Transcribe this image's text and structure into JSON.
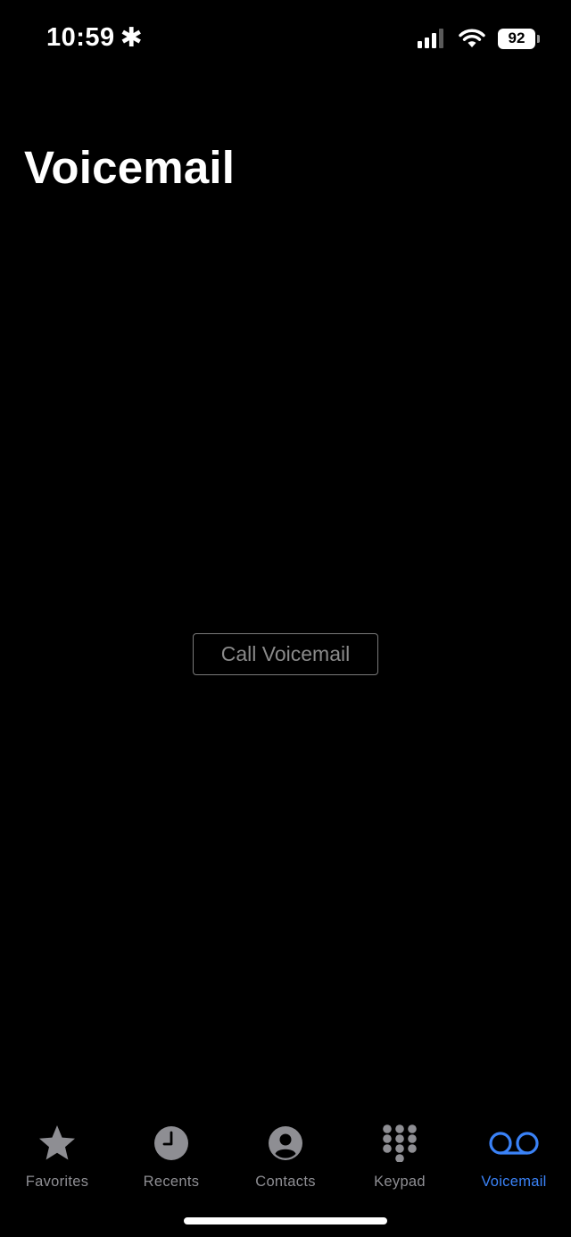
{
  "status_bar": {
    "time": "10:59",
    "time_suffix": "✱",
    "battery": "92"
  },
  "page": {
    "title": "Voicemail"
  },
  "main": {
    "call_voicemail_label": "Call Voicemail"
  },
  "tabs": [
    {
      "label": "Favorites",
      "icon": "star-icon",
      "active": false
    },
    {
      "label": "Recents",
      "icon": "clock-icon",
      "active": false
    },
    {
      "label": "Contacts",
      "icon": "person-circle-icon",
      "active": false
    },
    {
      "label": "Keypad",
      "icon": "keypad-icon",
      "active": false
    },
    {
      "label": "Voicemail",
      "icon": "voicemail-icon",
      "active": true
    }
  ],
  "colors": {
    "background": "#000000",
    "active_tab": "#3a82f7",
    "inactive_tab": "#8e8e93"
  }
}
